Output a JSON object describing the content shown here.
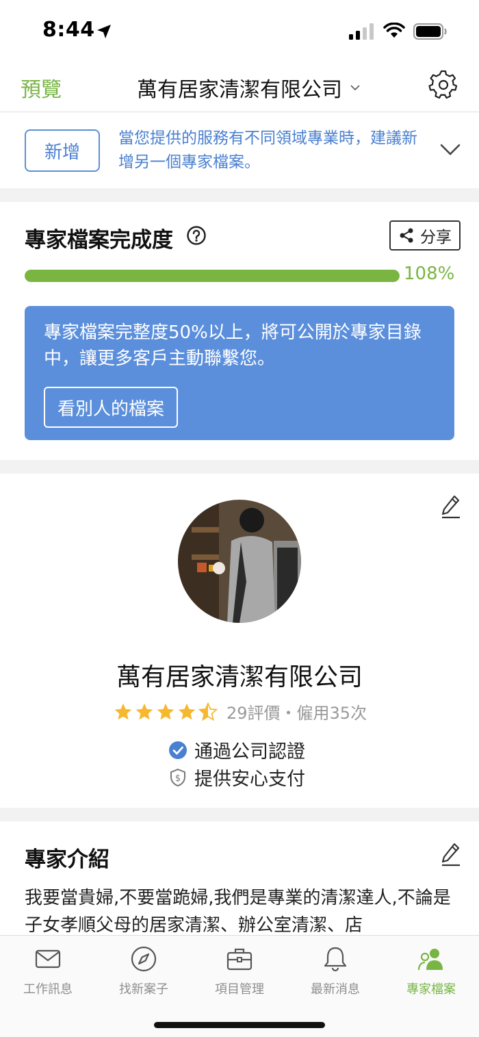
{
  "status_bar": {
    "time": "8:44"
  },
  "nav": {
    "preview_label": "預覽",
    "company_title": "萬有居家清潔有限公司"
  },
  "notice": {
    "add_label": "新增",
    "text": "當您提供的服務有不同領域專業時，建議新增另一個專家檔案。"
  },
  "completion": {
    "title": "專家檔案完成度",
    "share_label": "分享",
    "percent_text": "108%",
    "progress_fraction": 1.0,
    "info_text": "專家檔案完整度50%以上，將可公開於專家目錄中，讓更多客戶主動聯繫您。",
    "view_others_label": "看別人的檔案"
  },
  "profile": {
    "company_name": "萬有居家清潔有限公司",
    "rating": 4.5,
    "rating_text": "29評價・僱用35次",
    "verified_text": "通過公司認證",
    "payment_text": "提供安心支付"
  },
  "intro": {
    "title": "專家介紹",
    "text": "我要當貴婦,不要當跪婦,我們是專業的清潔達人,不論是子女孝順父母的居家清潔、辦公室清潔、店"
  },
  "tabs": [
    {
      "label": "工作訊息",
      "icon": "mail-icon",
      "active": false
    },
    {
      "label": "找新案子",
      "icon": "compass-icon",
      "active": false
    },
    {
      "label": "項目管理",
      "icon": "briefcase-icon",
      "active": false
    },
    {
      "label": "最新消息",
      "icon": "bell-icon",
      "active": false
    },
    {
      "label": "專家檔案",
      "icon": "user-group-icon",
      "active": true
    }
  ],
  "colors": {
    "brand_green": "#78b544",
    "brand_blue": "#5b8fdc",
    "star_yellow": "#f5b82e"
  }
}
